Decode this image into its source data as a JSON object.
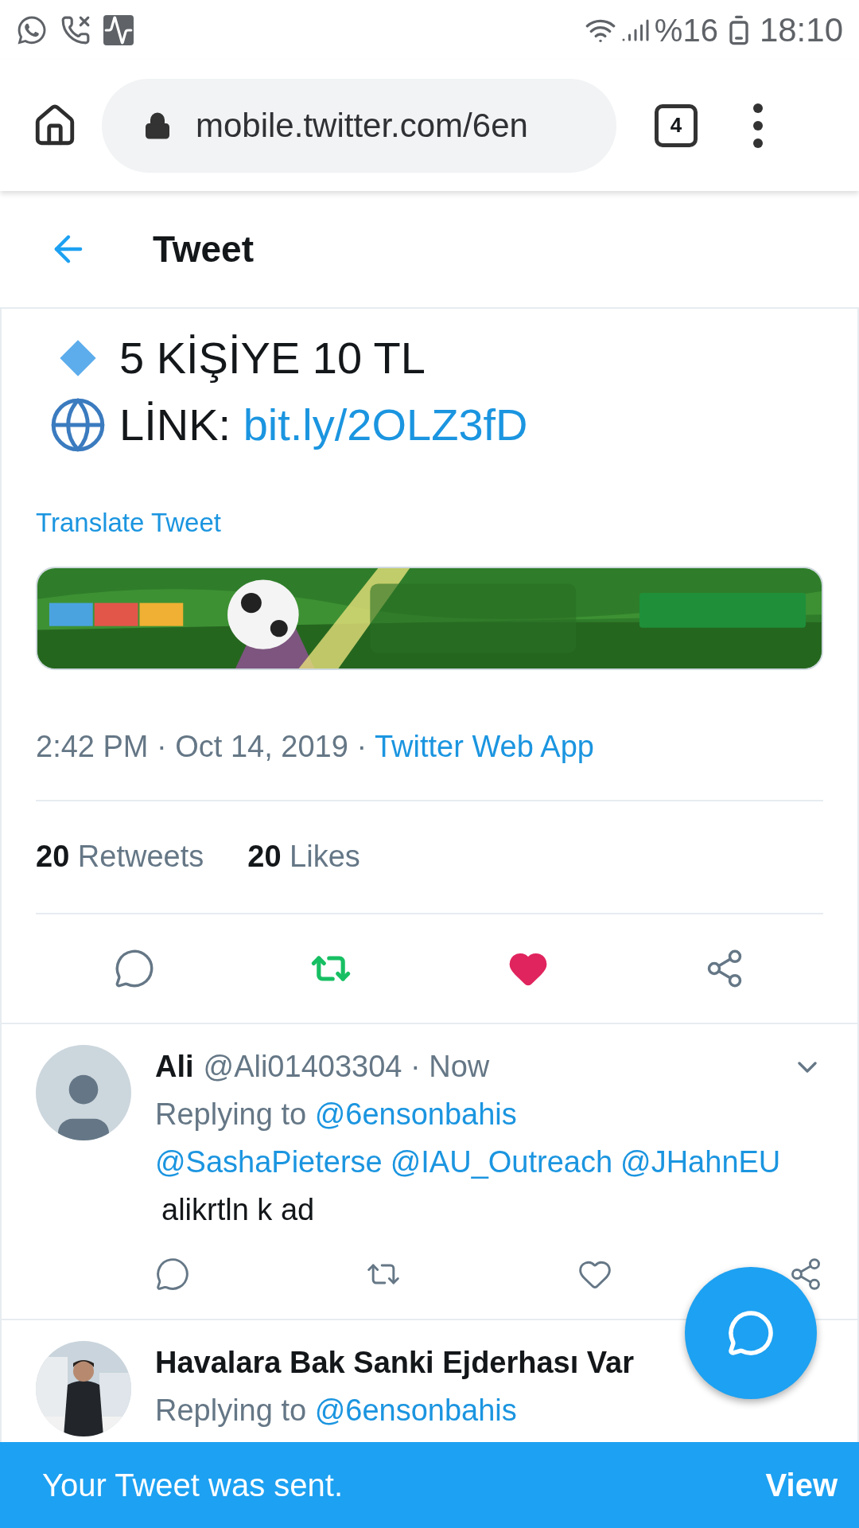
{
  "status_bar": {
    "battery": "%16",
    "time": "18:10"
  },
  "browser": {
    "url": "mobile.twitter.com/6en",
    "tab_count": "4"
  },
  "header": {
    "title": "Tweet"
  },
  "tweet": {
    "lines": [
      {
        "kind": "diamond",
        "text": "5 KİŞİYE 10 TL"
      },
      {
        "kind": "globe",
        "text": "LİNK: ",
        "link": "bit.ly/2OLZ3fD"
      }
    ],
    "translate": "Translate Tweet",
    "banner": {
      "kind": "picture"
    },
    "timestamp": "2:42 PM · Oct 14, 2019 · ",
    "source": "Twitter Web App",
    "stats": [
      "**20** Retweets",
      "**20** Likes"
    ],
    "retweeted": true,
    "liked": true
  },
  "replies": [
    {
      "name": "Ali",
      "handle": "@Ali01403304 · Now",
      "avatar": {
        "kind": "placeholder"
      },
      "replying_label": "Replying to ",
      "replying_to": "@6ensonbahis",
      "mentions": [
        "@SashaPieterse",
        "@IAU_Outreach",
        "@JHahnEU"
      ],
      "text": "alikrtln k ad",
      "retweeted": false,
      "liked": false
    },
    {
      "name": "Havalara Bak Sanki Ejderhası Var",
      "avatar": {
        "kind": "picture"
      },
      "replying_label": "Replying to ",
      "replying_to": "@6ensonbahis"
    }
  ],
  "toast": {
    "message": "Your Tweet was sent.",
    "action": "View"
  }
}
